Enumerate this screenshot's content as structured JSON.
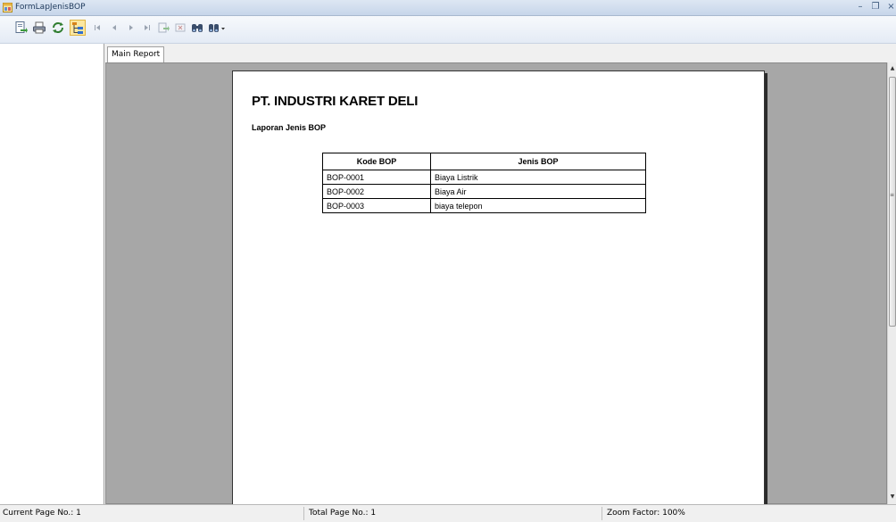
{
  "window": {
    "title": "FormLapJenisBOP",
    "icon": "form-icon"
  },
  "toolbar": {
    "buttons": [
      {
        "name": "export-icon",
        "enabled": true
      },
      {
        "name": "print-icon",
        "enabled": true
      },
      {
        "name": "refresh-icon",
        "enabled": true
      },
      {
        "name": "group-tree-icon",
        "enabled": true
      },
      {
        "name": "first-page-icon",
        "enabled": false
      },
      {
        "name": "previous-page-icon",
        "enabled": false
      },
      {
        "name": "next-page-icon",
        "enabled": false
      },
      {
        "name": "last-page-icon",
        "enabled": false
      },
      {
        "name": "goto-page-icon",
        "enabled": false
      },
      {
        "name": "close-view-icon",
        "enabled": false
      },
      {
        "name": "find-icon",
        "enabled": true
      },
      {
        "name": "zoom-icon",
        "enabled": true
      }
    ]
  },
  "tabs": [
    {
      "label": "Main Report",
      "active": true
    }
  ],
  "report": {
    "company": "PT. INDUSTRI KARET DELI",
    "subtitle": "Laporan Jenis BOP",
    "columns": [
      "Kode BOP",
      "Jenis BOP"
    ],
    "rows": [
      [
        "BOP-0001",
        "Biaya Listrik"
      ],
      [
        "BOP-0002",
        "Biaya Air"
      ],
      [
        "BOP-0003",
        "biaya telepon"
      ]
    ]
  },
  "status": {
    "current_page": "Current Page No.: 1",
    "total_page": "Total Page No.: 1",
    "zoom": "Zoom Factor: 100%"
  },
  "colors": {
    "viewer_background": "#a7a7a7",
    "titlebar": "#c7d6ea",
    "page": "#ffffff"
  }
}
